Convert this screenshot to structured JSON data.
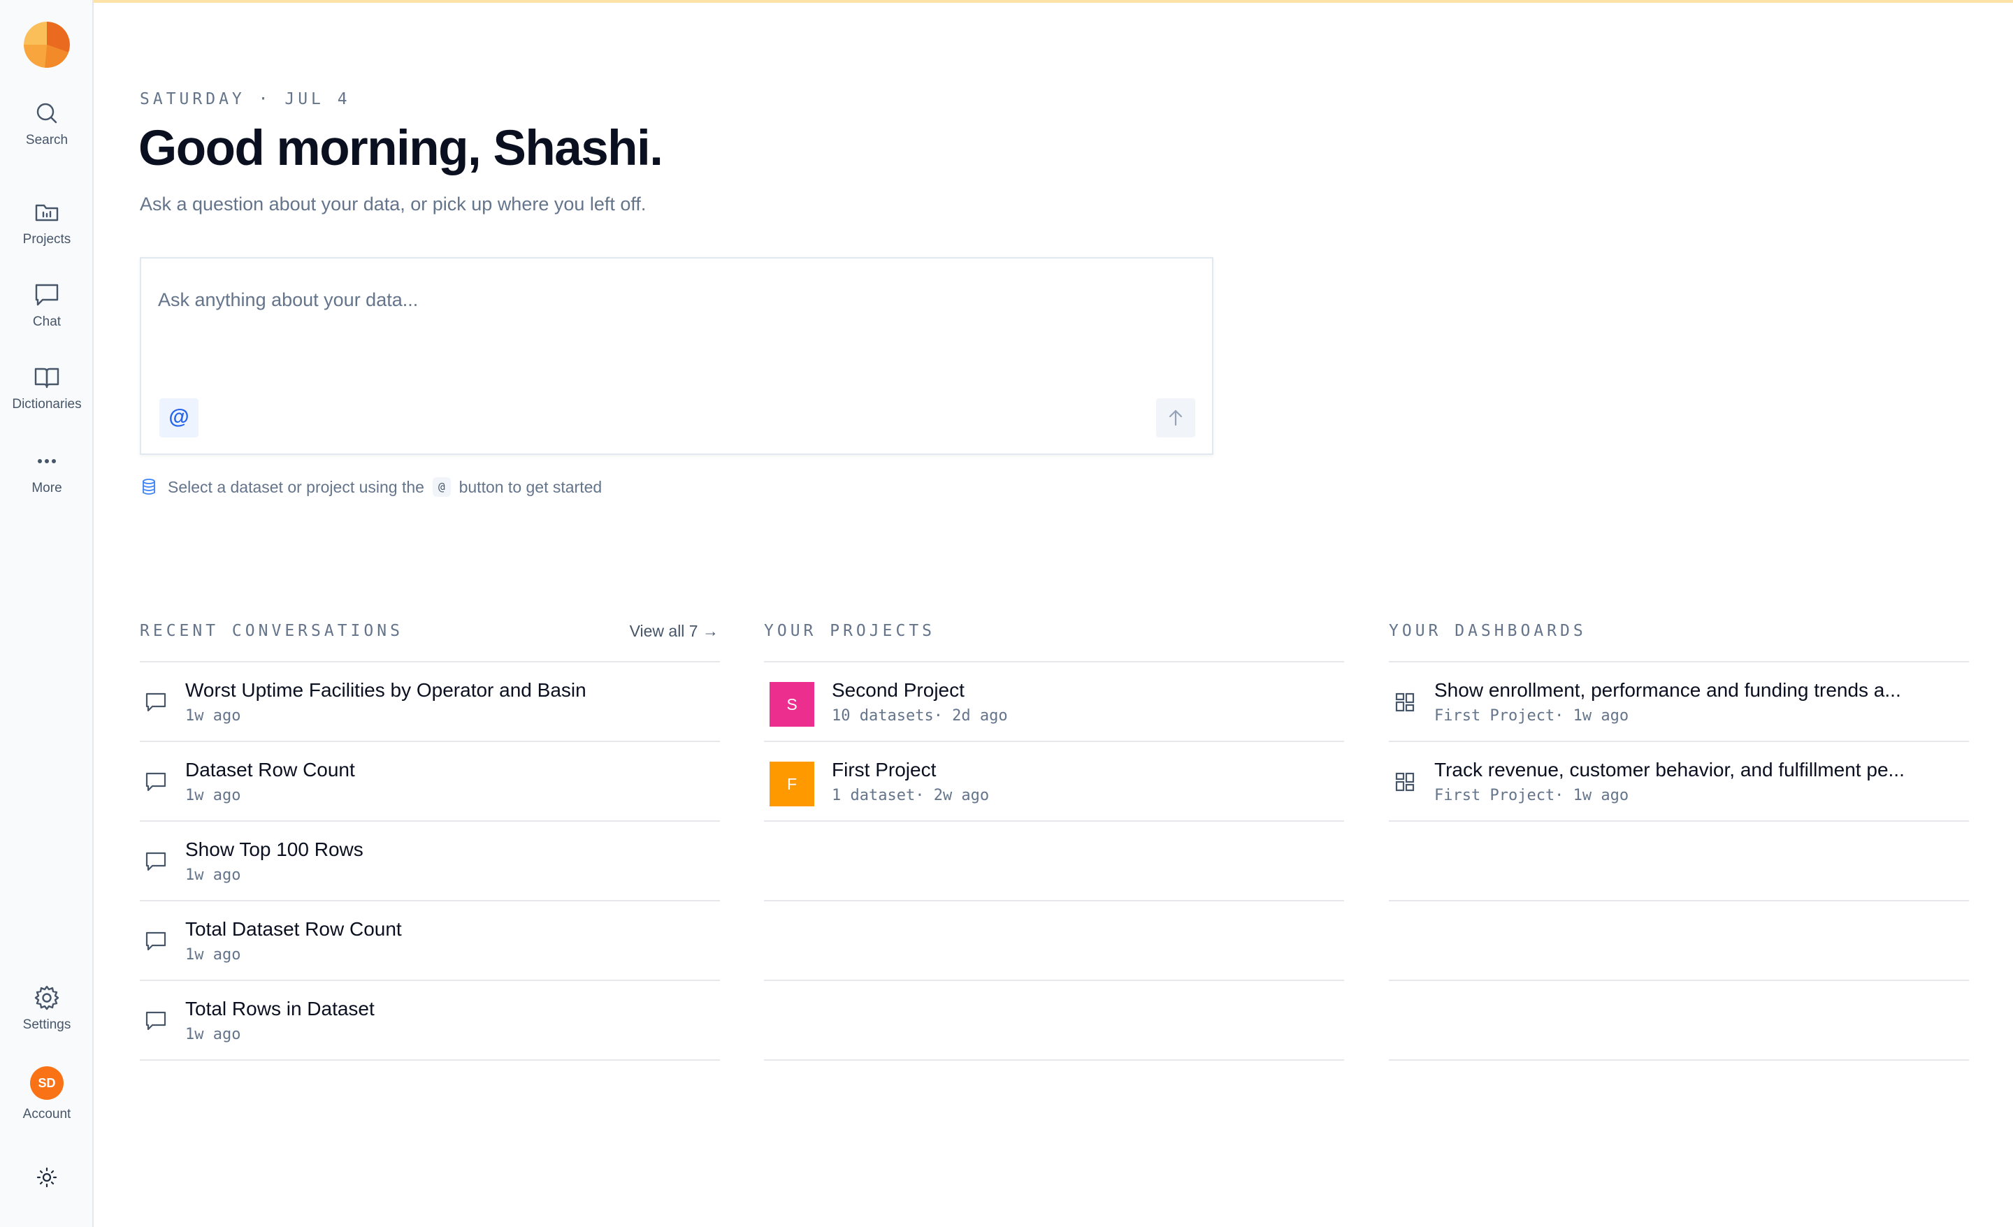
{
  "sidebar": {
    "items": [
      {
        "label": "Search",
        "icon": "search-icon"
      },
      {
        "label": "Projects",
        "icon": "folder-icon"
      },
      {
        "label": "Chat",
        "icon": "chat-icon"
      },
      {
        "label": "Dictionaries",
        "icon": "book-icon"
      },
      {
        "label": "More",
        "icon": "more-icon"
      }
    ],
    "settings_label": "Settings",
    "account_label": "Account",
    "avatar_initials": "SD",
    "theme_icon": "sun-icon"
  },
  "header": {
    "day": "SATURDAY",
    "separator": "·",
    "date": "JUL 4",
    "greeting": "Good morning, Shashi.",
    "subtitle": "Ask a question about your data, or pick up where you left off."
  },
  "ask": {
    "placeholder": "Ask anything about your data...",
    "mention_symbol": "@",
    "hint_before": "Select a dataset or project using the",
    "hint_chip": "@",
    "hint_after": "button to get started"
  },
  "recent_conversations": {
    "heading": "RECENT CONVERSATIONS",
    "view_all": "View all 7 →",
    "items": [
      {
        "title": "Worst Uptime Facilities by Operator and Basin",
        "meta": "1w ago"
      },
      {
        "title": "Dataset Row Count",
        "meta": "1w ago"
      },
      {
        "title": "Show Top 100 Rows",
        "meta": "1w ago"
      },
      {
        "title": "Total Dataset Row Count",
        "meta": "1w ago"
      },
      {
        "title": "Total Rows in Dataset",
        "meta": "1w ago"
      }
    ]
  },
  "projects": {
    "heading": "YOUR PROJECTS",
    "items": [
      {
        "letter": "S",
        "title": "Second Project",
        "meta": "10 datasets· 2d ago",
        "color": "#ec2f8f"
      },
      {
        "letter": "F",
        "title": "First Project",
        "meta": "1 dataset· 2w ago",
        "color": "#ff9900"
      }
    ]
  },
  "dashboards": {
    "heading": "YOUR DASHBOARDS",
    "items": [
      {
        "title": "Show enrollment, performance and funding trends a...",
        "meta": "First Project· 1w ago"
      },
      {
        "title": "Track revenue, customer behavior, and fulfillment pe...",
        "meta": "First Project· 1w ago"
      }
    ]
  },
  "colors": {
    "accent": "#2563eb",
    "logo_orange": "#f97316",
    "top_border": "#fde2a8"
  }
}
